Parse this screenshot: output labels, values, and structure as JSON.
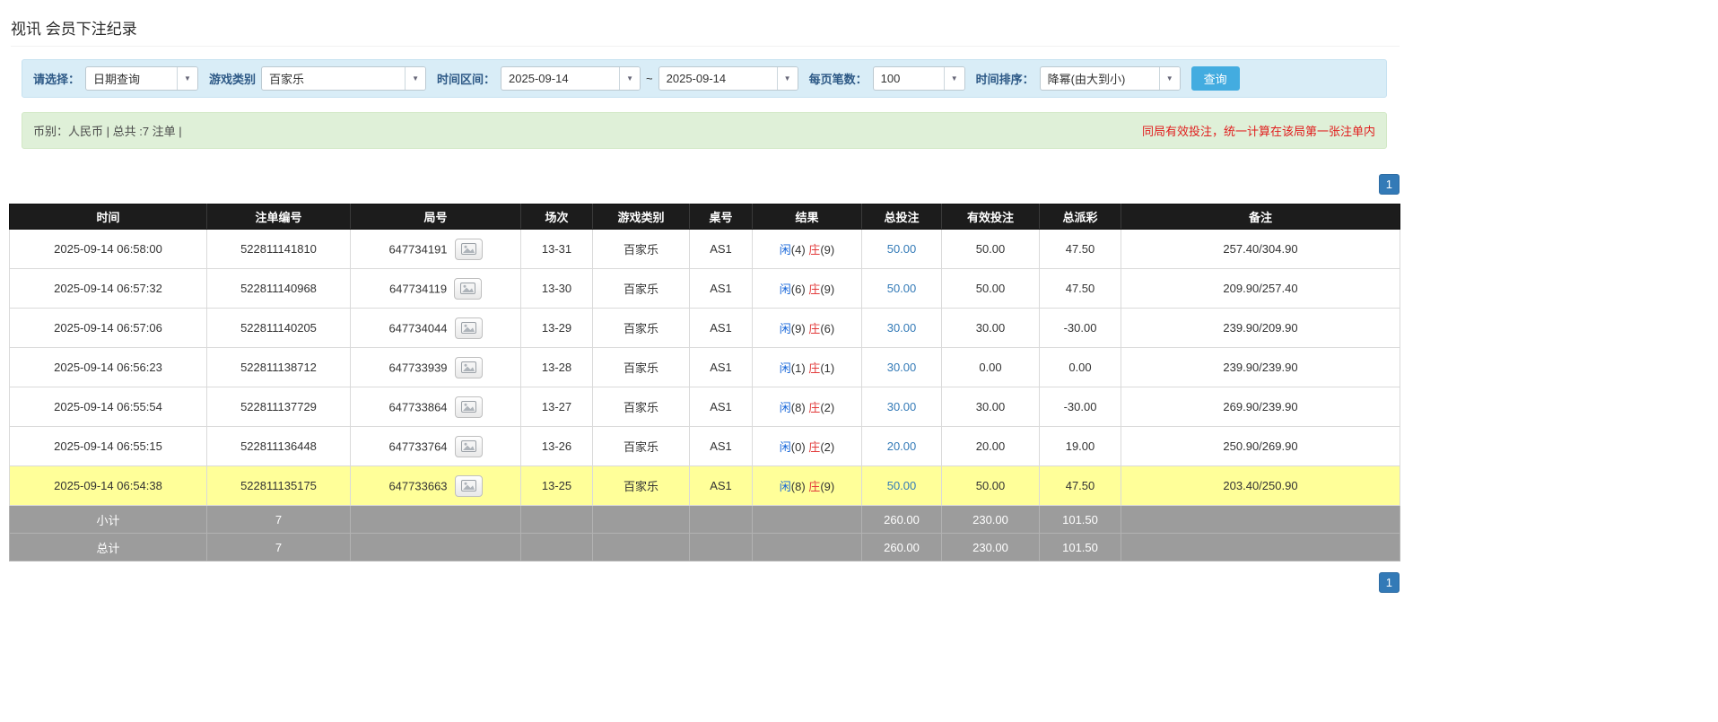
{
  "page_title": "视讯 会员下注纪录",
  "colors": {
    "accent_blue": "#337ab7",
    "button_blue": "#43ace0",
    "header_dark": "#1c1c1c",
    "highlight_yellow": "#ffff99",
    "negative_red": "#e23b3b",
    "player_blue": "#1565d8",
    "banker_red": "#e23b3b",
    "warning_red": "#e01e1e",
    "filter_bg": "#d9edf7",
    "info_bg": "#dff0d8",
    "footer_gray": "#9c9c9c"
  },
  "filter": {
    "select_label": "请选择：",
    "select_value": "日期查询",
    "game_type_label": "游戏类别",
    "game_type_value": "百家乐",
    "date_range_label": "时间区间：",
    "date_from": "2025-09-14",
    "date_separator": "~",
    "date_to": "2025-09-14",
    "page_size_label": "每页笔数：",
    "page_size_value": "100",
    "sort_label": "时间排序：",
    "sort_value": "降幂(由大到小)",
    "query_button_label": "查询"
  },
  "info_bar": {
    "left": "币别：人民币 | 总共 :7 注单 |",
    "right": "同局有效投注，统一计算在该局第一张注单内"
  },
  "pagination": {
    "current_page": "1"
  },
  "table": {
    "headers": [
      "时间",
      "注单编号",
      "局号",
      "场次",
      "游戏类别",
      "桌号",
      "结果",
      "总投注",
      "有效投注",
      "总派彩",
      "备注"
    ],
    "rows": [
      {
        "time": "2025-09-14 06:58:00",
        "bet_id": "522811141810",
        "round_id": "647734191",
        "session": "13-31",
        "game": "百家乐",
        "table": "AS1",
        "result": {
          "player": "闲(4)",
          "banker": "庄(9)"
        },
        "total_bet": "50.00",
        "valid_bet": "50.00",
        "payout": "47.50",
        "note": "257.40/304.90",
        "highlighted": false
      },
      {
        "time": "2025-09-14 06:57:32",
        "bet_id": "522811140968",
        "round_id": "647734119",
        "session": "13-30",
        "game": "百家乐",
        "table": "AS1",
        "result": {
          "player": "闲(6)",
          "banker": "庄(9)"
        },
        "total_bet": "50.00",
        "valid_bet": "50.00",
        "payout": "47.50",
        "note": "209.90/257.40",
        "highlighted": false
      },
      {
        "time": "2025-09-14 06:57:06",
        "bet_id": "522811140205",
        "round_id": "647734044",
        "session": "13-29",
        "game": "百家乐",
        "table": "AS1",
        "result": {
          "player": "闲(9)",
          "banker": "庄(6)"
        },
        "total_bet": "30.00",
        "valid_bet": "30.00",
        "payout": "-30.00",
        "note": "239.90/209.90",
        "highlighted": false
      },
      {
        "time": "2025-09-14 06:56:23",
        "bet_id": "522811138712",
        "round_id": "647733939",
        "session": "13-28",
        "game": "百家乐",
        "table": "AS1",
        "result": {
          "player": "闲(1)",
          "banker": "庄(1)"
        },
        "total_bet": "30.00",
        "valid_bet": "0.00",
        "payout": "0.00",
        "note": "239.90/239.90",
        "highlighted": false
      },
      {
        "time": "2025-09-14 06:55:54",
        "bet_id": "522811137729",
        "round_id": "647733864",
        "session": "13-27",
        "game": "百家乐",
        "table": "AS1",
        "result": {
          "player": "闲(8)",
          "banker": "庄(2)"
        },
        "total_bet": "30.00",
        "valid_bet": "30.00",
        "payout": "-30.00",
        "note": "269.90/239.90",
        "highlighted": false
      },
      {
        "time": "2025-09-14 06:55:15",
        "bet_id": "522811136448",
        "round_id": "647733764",
        "session": "13-26",
        "game": "百家乐",
        "table": "AS1",
        "result": {
          "player": "闲(0)",
          "banker": "庄(2)"
        },
        "total_bet": "20.00",
        "valid_bet": "20.00",
        "payout": "19.00",
        "note": "250.90/269.90",
        "highlighted": false
      },
      {
        "time": "2025-09-14 06:54:38",
        "bet_id": "522811135175",
        "round_id": "647733663",
        "session": "13-25",
        "game": "百家乐",
        "table": "AS1",
        "result": {
          "player": "闲(8)",
          "banker": "庄(9)"
        },
        "total_bet": "50.00",
        "valid_bet": "50.00",
        "payout": "47.50",
        "note": "203.40/250.90",
        "highlighted": true
      }
    ],
    "subtotal": {
      "label": "小计",
      "count": "7",
      "total_bet": "260.00",
      "valid_bet": "230.00",
      "payout": "101.50"
    },
    "total": {
      "label": "总计",
      "count": "7",
      "total_bet": "260.00",
      "valid_bet": "230.00",
      "payout": "101.50"
    }
  }
}
